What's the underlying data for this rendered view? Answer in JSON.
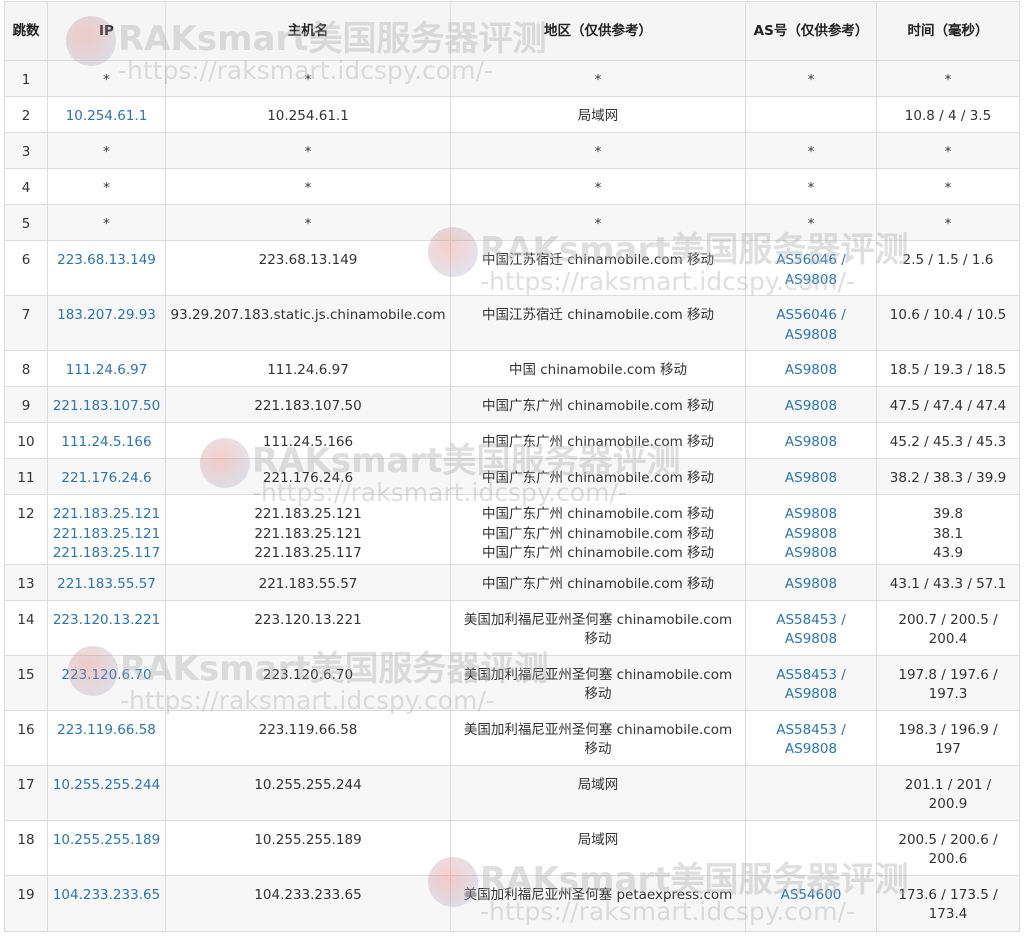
{
  "headers": {
    "hop": "跳数",
    "ip": "IP",
    "host": "主机名",
    "region": "地区（仅供参考）",
    "as": "AS号（仅供参考）",
    "time": "时间（毫秒）"
  },
  "rows": [
    {
      "hop": "1",
      "ip": [
        "*"
      ],
      "host": [
        "*"
      ],
      "region": [
        "*"
      ],
      "as": [
        "*"
      ],
      "time": [
        "*"
      ],
      "ip_link": false,
      "as_link": false
    },
    {
      "hop": "2",
      "ip": [
        "10.254.61.1"
      ],
      "host": [
        "10.254.61.1"
      ],
      "region": [
        "局域网"
      ],
      "as": [
        ""
      ],
      "time": [
        "10.8 / 4 / 3.5"
      ],
      "ip_link": true,
      "as_link": false
    },
    {
      "hop": "3",
      "ip": [
        "*"
      ],
      "host": [
        "*"
      ],
      "region": [
        "*"
      ],
      "as": [
        "*"
      ],
      "time": [
        "*"
      ],
      "ip_link": false,
      "as_link": false
    },
    {
      "hop": "4",
      "ip": [
        "*"
      ],
      "host": [
        "*"
      ],
      "region": [
        "*"
      ],
      "as": [
        "*"
      ],
      "time": [
        "*"
      ],
      "ip_link": false,
      "as_link": false
    },
    {
      "hop": "5",
      "ip": [
        "*"
      ],
      "host": [
        "*"
      ],
      "region": [
        "*"
      ],
      "as": [
        "*"
      ],
      "time": [
        "*"
      ],
      "ip_link": false,
      "as_link": false
    },
    {
      "hop": "6",
      "ip": [
        "223.68.13.149"
      ],
      "host": [
        "223.68.13.149"
      ],
      "region": [
        "中国江苏宿迁 chinamobile.com 移动"
      ],
      "as": [
        "AS56046 /",
        "AS9808"
      ],
      "time": [
        "2.5 / 1.5 / 1.6"
      ],
      "ip_link": true,
      "as_link": true
    },
    {
      "hop": "7",
      "ip": [
        "183.207.29.93"
      ],
      "host": [
        "93.29.207.183.static.js.chinamobile.com"
      ],
      "region": [
        "中国江苏宿迁 chinamobile.com 移动"
      ],
      "as": [
        "AS56046 /",
        "AS9808"
      ],
      "time": [
        "10.6 / 10.4 / 10.5"
      ],
      "ip_link": true,
      "as_link": true
    },
    {
      "hop": "8",
      "ip": [
        "111.24.6.97"
      ],
      "host": [
        "111.24.6.97"
      ],
      "region": [
        "中国 chinamobile.com 移动"
      ],
      "as": [
        "AS9808"
      ],
      "time": [
        "18.5 / 19.3 / 18.5"
      ],
      "ip_link": true,
      "as_link": true
    },
    {
      "hop": "9",
      "ip": [
        "221.183.107.50"
      ],
      "host": [
        "221.183.107.50"
      ],
      "region": [
        "中国广东广州 chinamobile.com 移动"
      ],
      "as": [
        "AS9808"
      ],
      "time": [
        "47.5 / 47.4 / 47.4"
      ],
      "ip_link": true,
      "as_link": true
    },
    {
      "hop": "10",
      "ip": [
        "111.24.5.166"
      ],
      "host": [
        "111.24.5.166"
      ],
      "region": [
        "中国广东广州 chinamobile.com 移动"
      ],
      "as": [
        "AS9808"
      ],
      "time": [
        "45.2 / 45.3 / 45.3"
      ],
      "ip_link": true,
      "as_link": true
    },
    {
      "hop": "11",
      "ip": [
        "221.176.24.6"
      ],
      "host": [
        "221.176.24.6"
      ],
      "region": [
        "中国广东广州 chinamobile.com 移动"
      ],
      "as": [
        "AS9808"
      ],
      "time": [
        "38.2 / 38.3 / 39.9"
      ],
      "ip_link": true,
      "as_link": true
    },
    {
      "hop": "12",
      "ip": [
        "221.183.25.121",
        "221.183.25.121",
        "221.183.25.117"
      ],
      "host": [
        "221.183.25.121",
        "221.183.25.121",
        "221.183.25.117"
      ],
      "region": [
        "中国广东广州 chinamobile.com 移动",
        "中国广东广州 chinamobile.com 移动",
        "中国广东广州 chinamobile.com 移动"
      ],
      "as": [
        "AS9808",
        "AS9808",
        "AS9808"
      ],
      "time": [
        "39.8",
        "38.1",
        "43.9"
      ],
      "ip_link": true,
      "as_link": true
    },
    {
      "hop": "13",
      "ip": [
        "221.183.55.57"
      ],
      "host": [
        "221.183.55.57"
      ],
      "region": [
        "中国广东广州 chinamobile.com 移动"
      ],
      "as": [
        "AS9808"
      ],
      "time": [
        "43.1 / 43.3 / 57.1"
      ],
      "ip_link": true,
      "as_link": true
    },
    {
      "hop": "14",
      "ip": [
        "223.120.13.221"
      ],
      "host": [
        "223.120.13.221"
      ],
      "region": [
        "美国加利福尼亚州圣何塞 chinamobile.com",
        "移动"
      ],
      "as": [
        "AS58453 /",
        "AS9808"
      ],
      "time": [
        "200.7 / 200.5 /",
        "200.4"
      ],
      "ip_link": true,
      "as_link": true
    },
    {
      "hop": "15",
      "ip": [
        "223.120.6.70"
      ],
      "host": [
        "223.120.6.70"
      ],
      "region": [
        "美国加利福尼亚州圣何塞 chinamobile.com",
        "移动"
      ],
      "as": [
        "AS58453 /",
        "AS9808"
      ],
      "time": [
        "197.8 / 197.6 /",
        "197.3"
      ],
      "ip_link": true,
      "as_link": true
    },
    {
      "hop": "16",
      "ip": [
        "223.119.66.58"
      ],
      "host": [
        "223.119.66.58"
      ],
      "region": [
        "美国加利福尼亚州圣何塞 chinamobile.com",
        "移动"
      ],
      "as": [
        "AS58453 /",
        "AS9808"
      ],
      "time": [
        "198.3 / 196.9 /",
        "197"
      ],
      "ip_link": true,
      "as_link": true
    },
    {
      "hop": "17",
      "ip": [
        "10.255.255.244"
      ],
      "host": [
        "10.255.255.244"
      ],
      "region": [
        "局域网"
      ],
      "as": [
        ""
      ],
      "time": [
        "201.1 / 201 /",
        "200.9"
      ],
      "ip_link": true,
      "as_link": false
    },
    {
      "hop": "18",
      "ip": [
        "10.255.255.189"
      ],
      "host": [
        "10.255.255.189"
      ],
      "region": [
        "局域网"
      ],
      "as": [
        ""
      ],
      "time": [
        "200.5 / 200.6 /",
        "200.6"
      ],
      "ip_link": true,
      "as_link": false
    },
    {
      "hop": "19",
      "ip": [
        "104.233.233.65"
      ],
      "host": [
        "104.233.233.65"
      ],
      "region": [
        "美国加利福尼亚州圣何塞 petaexpress.com"
      ],
      "as": [
        "AS54600"
      ],
      "time": [
        "173.6 / 173.5 /",
        "173.4"
      ],
      "ip_link": true,
      "as_link": true
    }
  ],
  "watermark": {
    "title": "RAKsmart美国服务器评测",
    "url": "-https://raksmart.idcspy.com/-"
  }
}
